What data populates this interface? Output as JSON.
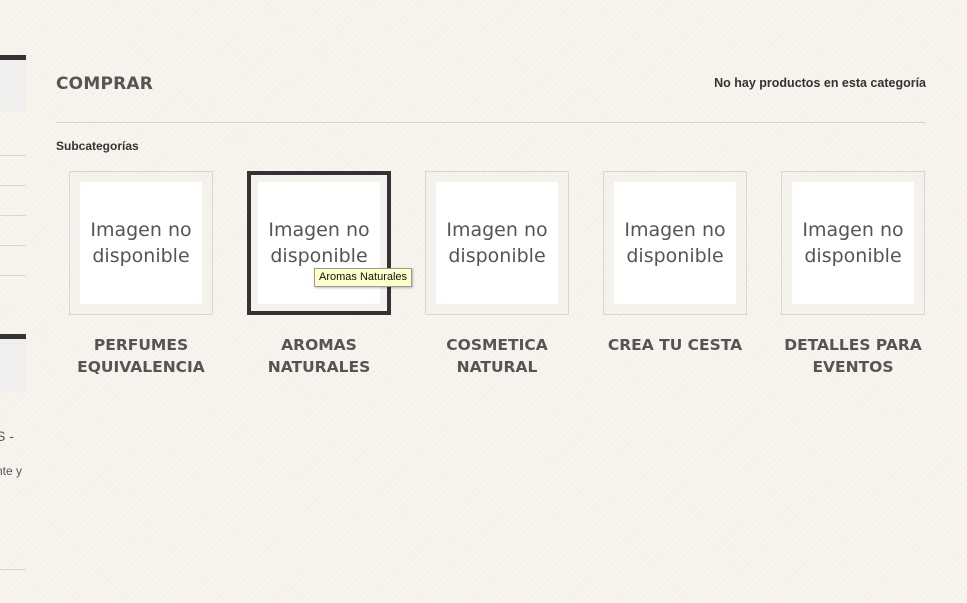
{
  "sidebar": {
    "partial_text_1": "S -",
    "partial_text_2": "nte y"
  },
  "category": {
    "title": "COMPRAR",
    "no_products_message": "No hay productos en esta categoría"
  },
  "subcategories": {
    "heading": "Subcategorías",
    "items": [
      {
        "image_text": "Imagen no disponible",
        "name": "PERFUMES EQUIVALENCIA",
        "hovered": false
      },
      {
        "image_text": "Imagen no disponible",
        "name": "AROMAS NATURALES",
        "hovered": true
      },
      {
        "image_text": "Imagen no disponible",
        "name": "COSMETICA NATURAL",
        "hovered": false
      },
      {
        "image_text": "Imagen no disponible",
        "name": "CREA TU CESTA",
        "hovered": false
      },
      {
        "image_text": "Imagen no disponible",
        "name": "DETALLES PARA EVENTOS",
        "hovered": false
      }
    ]
  },
  "tooltip": {
    "text": "Aromas Naturales"
  },
  "colors": {
    "background": "#f7f3ec",
    "text": "#555555",
    "active_border": "#333333",
    "tooltip_bg": "#ffffc9"
  }
}
